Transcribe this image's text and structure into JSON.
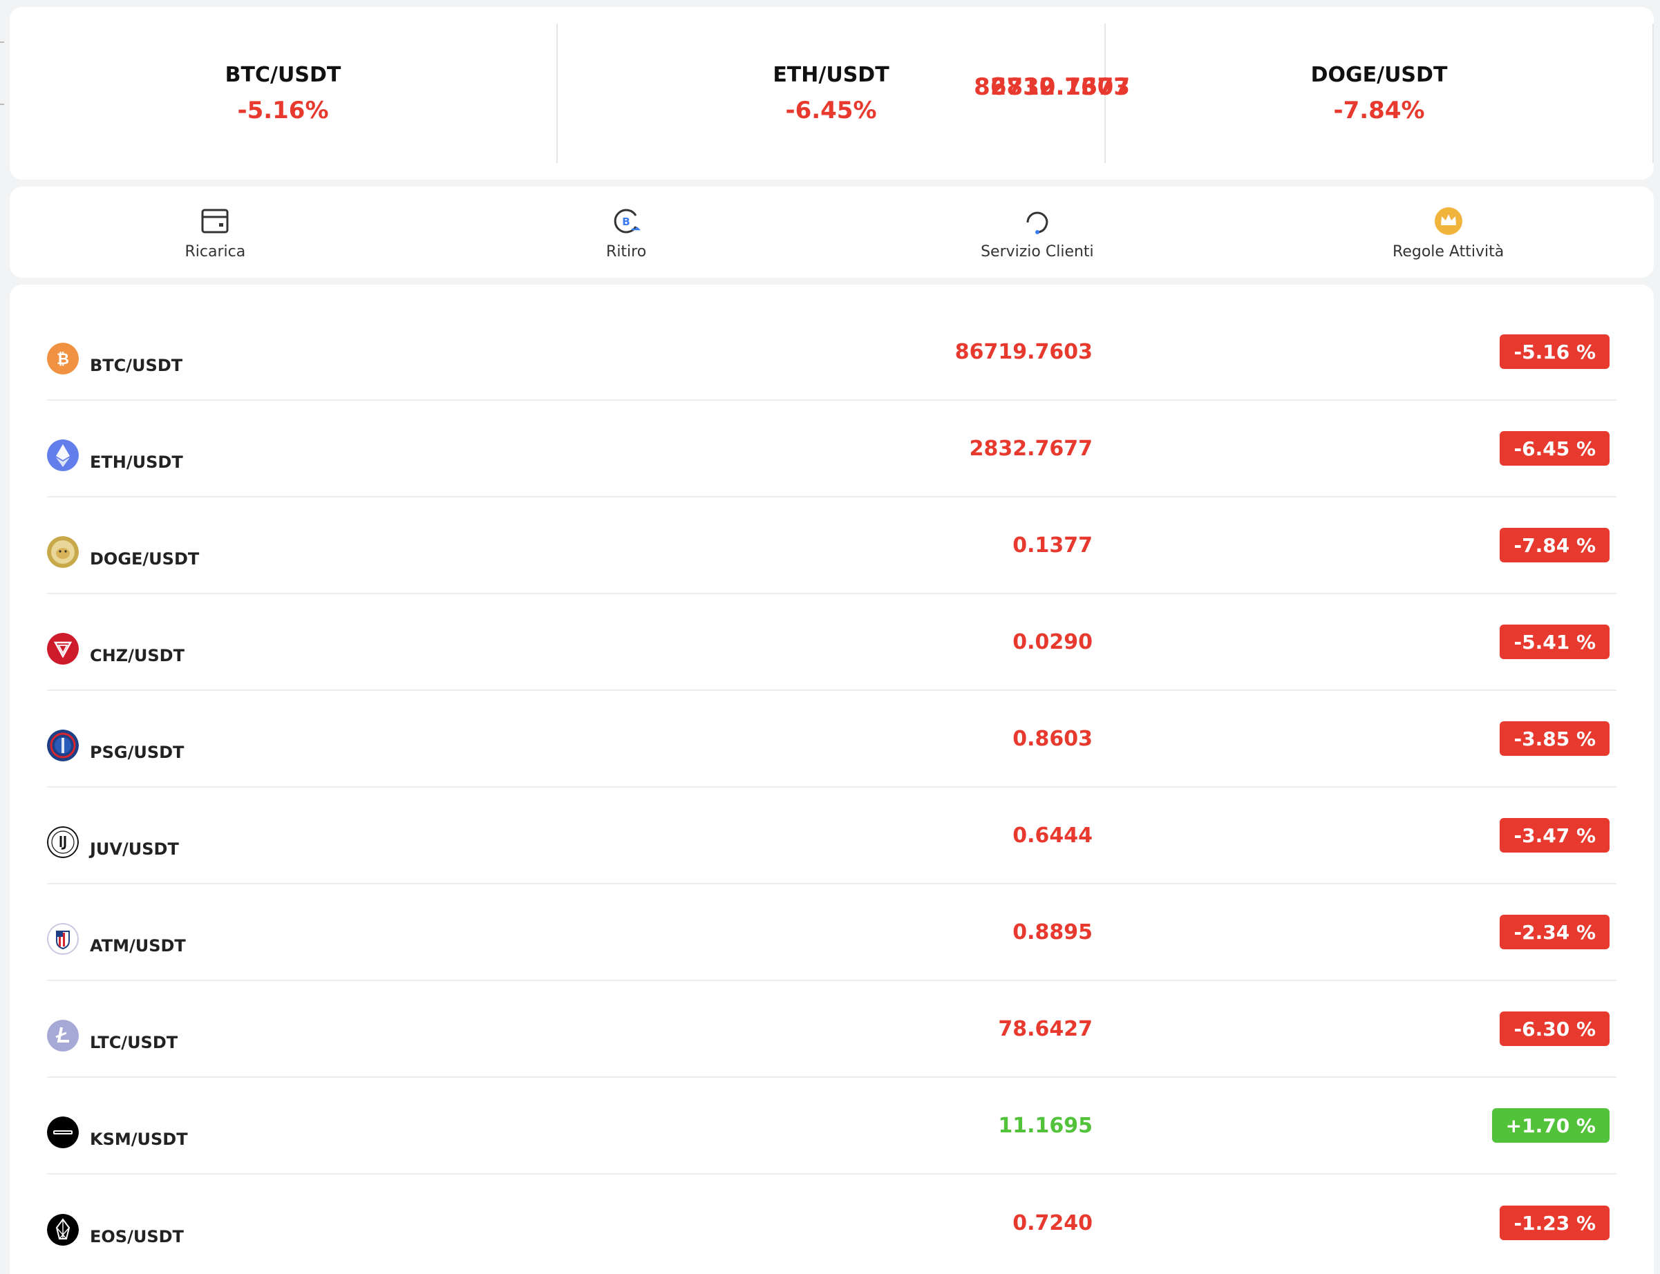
{
  "tickers": [
    {
      "pair": "BTC/USDT",
      "price": "86719.7603",
      "change": "-5.16%"
    },
    {
      "pair": "ETH/USDT",
      "price": "2832.7677",
      "change": "-6.45%"
    },
    {
      "pair": "DOGE/USDT",
      "price": "0.1377",
      "change": "-7.84%"
    }
  ],
  "menu": [
    {
      "label": "Ricarica",
      "icon": "wallet-icon"
    },
    {
      "label": "Ritiro",
      "icon": "bitcoin-withdraw-icon"
    },
    {
      "label": "Servizio Clienti",
      "icon": "headset-icon"
    },
    {
      "label": "Regole Attività",
      "icon": "crown-icon"
    }
  ],
  "market": [
    {
      "pair": "BTC/USDT",
      "price": "86719.7603",
      "change": "-5.16 %",
      "trend": "down",
      "icon": "bitcoin-icon",
      "color": "#f09242"
    },
    {
      "pair": "ETH/USDT",
      "price": "2832.7677",
      "change": "-6.45 %",
      "trend": "down",
      "icon": "ethereum-icon",
      "color": "#627eea"
    },
    {
      "pair": "DOGE/USDT",
      "price": "0.1377",
      "change": "-7.84 %",
      "trend": "down",
      "icon": "dogecoin-icon",
      "color": "#c8a94a"
    },
    {
      "pair": "CHZ/USDT",
      "price": "0.0290",
      "change": "-5.41 %",
      "trend": "down",
      "icon": "chiliz-icon",
      "color": "#cd1b2b"
    },
    {
      "pair": "PSG/USDT",
      "price": "0.8603",
      "change": "-3.85 %",
      "trend": "down",
      "icon": "psg-icon",
      "color": "#1c3f85"
    },
    {
      "pair": "JUV/USDT",
      "price": "0.6444",
      "change": "-3.47 %",
      "trend": "down",
      "icon": "juventus-icon",
      "color": "#111111"
    },
    {
      "pair": "ATM/USDT",
      "price": "0.8895",
      "change": "-2.34 %",
      "trend": "down",
      "icon": "atletico-icon",
      "color": "#d6252f"
    },
    {
      "pair": "LTC/USDT",
      "price": "78.6427",
      "change": "-6.30 %",
      "trend": "down",
      "icon": "litecoin-icon",
      "color": "#a6a9d6"
    },
    {
      "pair": "KSM/USDT",
      "price": "11.1695",
      "change": "+1.70 %",
      "trend": "up",
      "icon": "kusama-icon",
      "color": "#000000"
    },
    {
      "pair": "EOS/USDT",
      "price": "0.7240",
      "change": "-1.23 %",
      "trend": "down",
      "icon": "eos-icon",
      "color": "#000000"
    }
  ],
  "colors": {
    "down": "#e8392f",
    "up": "#52c23a"
  }
}
